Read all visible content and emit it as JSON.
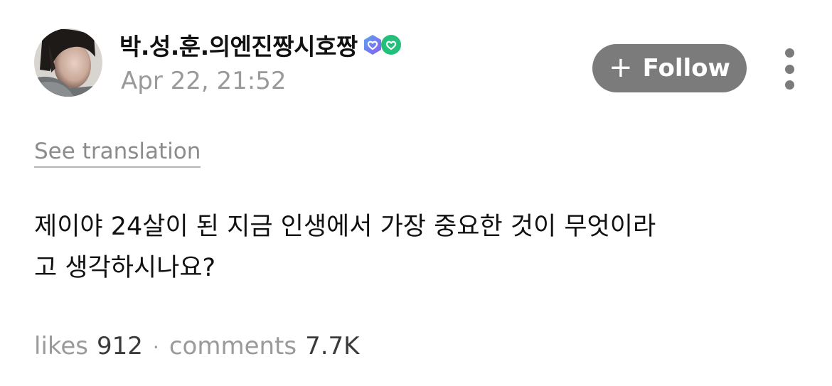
{
  "author": {
    "username": "박.성.훈.의엔진짱시호짱",
    "timestamp": "Apr 22, 21:52"
  },
  "actions": {
    "follow_label": "Follow"
  },
  "post": {
    "translate_label": "See translation",
    "text_line_1": "제이야 24살이 된 지금 인생에서 가장 중요한 것이 무엇이라",
    "text_line_2": "고 생각하시나요?"
  },
  "stats": {
    "likes_label": "likes",
    "likes_count": "912",
    "separator": "·",
    "comments_label": "comments",
    "comments_count": "7.7K"
  },
  "icons": {
    "avatar": "profile-photo",
    "badge_1": "verified-heart-badge-blue-purple",
    "badge_2": "verified-heart-badge-green",
    "follow": "plus-icon",
    "more": "vertical-ellipsis-icon"
  },
  "colors": {
    "follow_bg": "#7b7b7b",
    "muted_text": "#9a9a9a",
    "badge_gradient_start": "#5aa3f0",
    "badge_gradient_end": "#8a5cf0",
    "badge_green": "#22c07a"
  }
}
